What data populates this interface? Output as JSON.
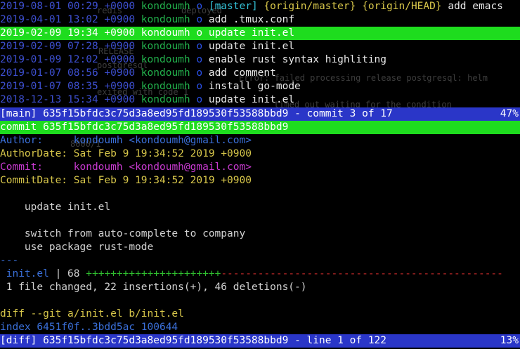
{
  "log": {
    "rows": [
      {
        "date": "2019-08-01 00:29 +0000",
        "author": "kondoumh",
        "node": "o",
        "refs_open": "[master]",
        "refs_origin": "{origin/master}",
        "refs_head": "{origin/HEAD}",
        "msg": "add emacs"
      },
      {
        "date": "2019-04-01 13:02 +0900",
        "author": "kondoumh",
        "node": "o",
        "msg": "add .tmux.conf"
      },
      {
        "date": "2019-02-09 19:34 +0900",
        "author": "kondoumh",
        "node": "o",
        "msg": "update init.el",
        "selected": true
      },
      {
        "date": "2019-02-09 07:28 +0900",
        "author": "kondoumh",
        "node": "o",
        "msg": "update init.el"
      },
      {
        "date": "2019-01-09 12:02 +0900",
        "author": "kondoumh",
        "node": "o",
        "msg": "enable rust syntax highliting"
      },
      {
        "date": "2019-01-07 08:56 +0900",
        "author": "kondoumh",
        "node": "o",
        "msg": "add comment"
      },
      {
        "date": "2019-01-07 08:35 +0900",
        "author": "kondoumh",
        "node": "o",
        "msg": "install go-mode"
      },
      {
        "date": "2018-12-13 15:34 +0900",
        "author": "kondoumh",
        "node": "o",
        "msg": "update init.el"
      }
    ],
    "status": {
      "view": "[main]",
      "hash": "635f15bfdc3c75d3a8ed95fd189530f53588bbd9",
      "position": "- commit 3 of 17",
      "percent": "47%"
    }
  },
  "diff": {
    "commit_line": "commit 635f15bfdc3c75d3a8ed95fd189530f53588bbd9",
    "author_label": "Author:",
    "author_value": "kondoumh <kondoumh@gmail.com>",
    "authordate_label": "AuthorDate:",
    "authordate_value": "Sat Feb 9 19:34:52 2019 +0900",
    "commit_label": "Commit:",
    "commit_value": "kondoumh <kondoumh@gmail.com>",
    "commitdate_label": "CommitDate:",
    "commitdate_value": "Sat Feb 9 19:34:52 2019 +0900",
    "subject": "update init.el",
    "body_line1": "switch from auto-complete to company",
    "body_line2": "use package rust-mode",
    "separator": "---",
    "stat_file": "init.el",
    "stat_pipe": "|",
    "stat_count": "68",
    "stat_plus": "++++++++++++++++++++++",
    "stat_minus": "----------------------------------------------",
    "summary": "1 file changed, 22 insertions(+), 46 deletions(-)",
    "diff_git": "diff --git a/init.el b/init.el",
    "index_line": "index 6451f0f..3bdd5ac 100644",
    "status": {
      "view": "[diff]",
      "hash": "635f15bfdc3c75d3a8ed95fd189530f53588bbd9",
      "position": "- line 1 of 122",
      "percent": "13%"
    }
  },
  "background_ghost": {
    "l1": "redis",
    "l2": "deployed",
    "l3": "RELEASE",
    "l4": "postgresql",
    "l5": "Error: failed processing release postgresql: helm",
    "l6": "exited with code 1",
    "l7": "timed out waiting for the condition",
    "l8": "8000/1"
  },
  "colors": {
    "selection": "#1edc1e",
    "status_bar": "#2a36c8",
    "date": "#3d4fd0",
    "author": "#22b14c"
  }
}
